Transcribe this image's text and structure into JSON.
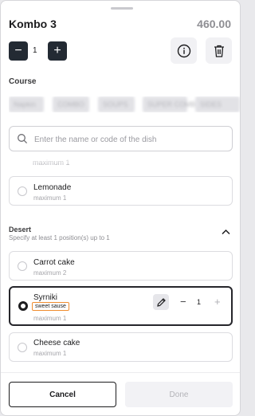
{
  "header": {
    "title": "Kombo 3",
    "price": "460.00"
  },
  "quantity": {
    "minus": "−",
    "value": "1",
    "plus": "+"
  },
  "course": {
    "label": "Course",
    "chips": [
      "Napkin",
      "COMBO",
      "SOUPS",
      "SUPER COMBO",
      "SIDES"
    ]
  },
  "search": {
    "placeholder": "Enter the name or code of the dish",
    "value": ""
  },
  "course_items": {
    "faded_max": "maximum 1",
    "items": [
      {
        "name": "Lemonade",
        "max": "maximum 1"
      }
    ]
  },
  "desert": {
    "title": "Desert",
    "hint": "Specify at least 1 position(s)  up to 1",
    "items": [
      {
        "name": "Carrot cake",
        "max": "maximum 2"
      },
      {
        "name": "Syrniki",
        "note": "sweet sause",
        "max": "maximum 1",
        "count": "1",
        "minus": "−",
        "plus": "+"
      },
      {
        "name": "Cheese cake",
        "max": "maximum 1"
      }
    ]
  },
  "footer": {
    "cancel": "Cancel",
    "done": "Done"
  },
  "colors": {
    "dark": "#232a33",
    "note_border": "#f08c2f",
    "muted": "#8e8e93"
  }
}
